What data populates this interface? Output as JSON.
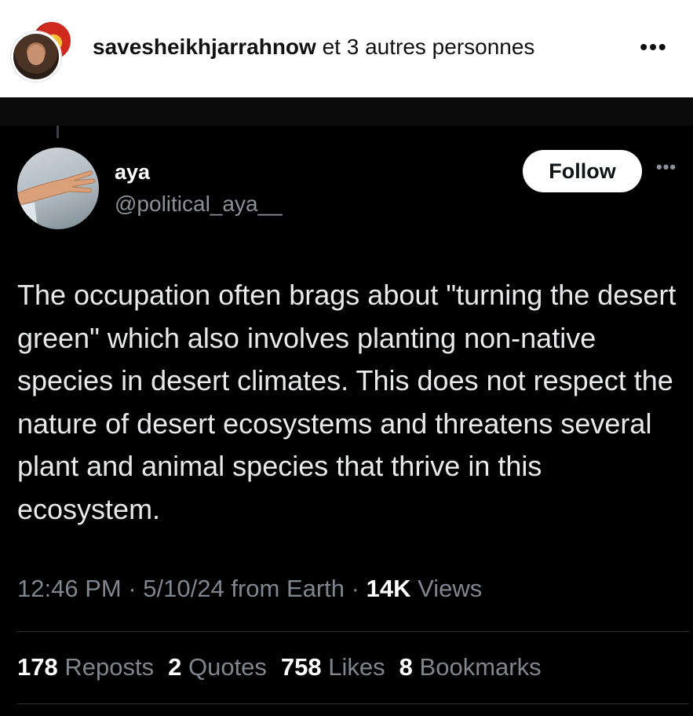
{
  "header": {
    "primary_account": "savesheikhjarrahnow",
    "others_text": "et 3 autres personnes",
    "more_glyph": "•••",
    "icons": [
      "avatar",
      "more-options-icon"
    ]
  },
  "tweet": {
    "author_name": "aya",
    "author_handle": "@political_aya__",
    "follow_label": "Follow",
    "more_glyph": "•••",
    "text": "The occupation often brags about \"turning the desert green\" which also involves planting non-native species in desert climates. This does not respect the nature of desert ecosystems and threatens several plant and animal species that thrive in this ecosystem.",
    "time": "12:46 PM",
    "date": "5/10/24",
    "source": "from Earth",
    "separator": " · ",
    "views_count": "14K",
    "views_label": "Views",
    "stats": {
      "reposts_count": "178",
      "reposts_label": "Reposts",
      "quotes_count": "2",
      "quotes_label": "Quotes",
      "likes_count": "758",
      "likes_label": "Likes",
      "bookmarks_count": "8",
      "bookmarks_label": "Bookmarks"
    }
  },
  "colors": {
    "tweet_background": "#000000",
    "tweet_text": "#e7e9ea",
    "muted_text": "#7f868d",
    "follow_button": "#ffffff"
  }
}
